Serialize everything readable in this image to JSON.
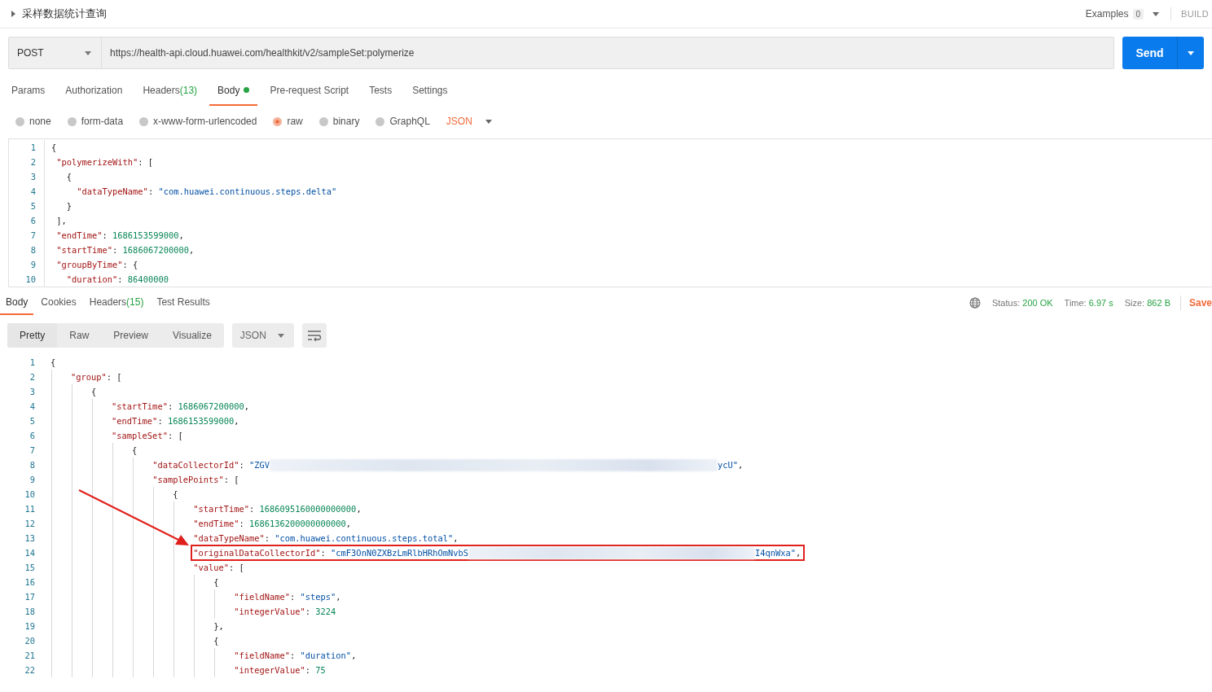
{
  "header": {
    "title": "采样数据统计查询",
    "examples_label": "Examples",
    "examples_count": "0",
    "build_label": "BUILD"
  },
  "request": {
    "method": "POST",
    "url": "https://health-api.cloud.huawei.com/healthkit/v2/sampleSet:polymerize",
    "send_label": "Send"
  },
  "request_tabs": [
    {
      "label": "Params",
      "selected": false
    },
    {
      "label": "Authorization",
      "selected": false
    },
    {
      "label": "Headers",
      "count": "(13)",
      "selected": false
    },
    {
      "label": "Body",
      "has_content": true,
      "selected": true
    },
    {
      "label": "Pre-request Script",
      "selected": false
    },
    {
      "label": "Tests",
      "selected": false
    },
    {
      "label": "Settings",
      "selected": false
    }
  ],
  "body_types": [
    {
      "label": "none",
      "selected": false
    },
    {
      "label": "form-data",
      "selected": false
    },
    {
      "label": "x-www-form-urlencoded",
      "selected": false
    },
    {
      "label": "raw",
      "selected": true
    },
    {
      "label": "binary",
      "selected": false
    },
    {
      "label": "GraphQL",
      "selected": false
    }
  ],
  "body_format": "JSON",
  "request_editor": {
    "lines": [
      {
        "number": "1",
        "highlighted": false,
        "tokens": [
          {
            "kind": "punct",
            "text": "{"
          }
        ]
      },
      {
        "number": "2",
        "highlighted": false,
        "tokens": [
          {
            "kind": "key",
            "text": " \"polymerizeWith\""
          },
          {
            "kind": "punct",
            "text": ": ["
          }
        ]
      },
      {
        "number": "3",
        "highlighted": false,
        "tokens": [
          {
            "kind": "punct",
            "text": "   {"
          }
        ]
      },
      {
        "number": "4",
        "highlighted": false,
        "tokens": [
          {
            "kind": "key",
            "text": "     \"dataTypeName\""
          },
          {
            "kind": "punct",
            "text": ": "
          },
          {
            "kind": "string",
            "text": "\"com.huawei.continuous.steps.delta\""
          }
        ]
      },
      {
        "number": "5",
        "highlighted": false,
        "tokens": [
          {
            "kind": "punct",
            "text": "   }"
          }
        ]
      },
      {
        "number": "6",
        "highlighted": false,
        "tokens": [
          {
            "kind": "punct",
            "text": " ],"
          }
        ]
      },
      {
        "number": "7",
        "highlighted": false,
        "tokens": [
          {
            "kind": "key",
            "text": " \"endTime\""
          },
          {
            "kind": "punct",
            "text": ": "
          },
          {
            "kind": "number",
            "text": "1686153599000"
          },
          {
            "kind": "punct",
            "text": ","
          }
        ]
      },
      {
        "number": "8",
        "highlighted": false,
        "tokens": [
          {
            "kind": "key",
            "text": " \"startTime\""
          },
          {
            "kind": "punct",
            "text": ": "
          },
          {
            "kind": "number",
            "text": "1686067200000"
          },
          {
            "kind": "punct",
            "text": ","
          }
        ]
      },
      {
        "number": "9",
        "highlighted": false,
        "tokens": [
          {
            "kind": "key",
            "text": " \"groupByTime\""
          },
          {
            "kind": "punct",
            "text": ": {"
          }
        ]
      },
      {
        "number": "10",
        "highlighted": false,
        "tokens": [
          {
            "kind": "key",
            "text": "   \"duration\""
          },
          {
            "kind": "punct",
            "text": ": "
          },
          {
            "kind": "number",
            "text": "86400000"
          }
        ]
      }
    ]
  },
  "response_tabs": [
    {
      "label": "Body",
      "selected": true
    },
    {
      "label": "Cookies",
      "selected": false
    },
    {
      "label": "Headers",
      "count": "(15)",
      "selected": false
    },
    {
      "label": "Test Results",
      "selected": false
    }
  ],
  "response_stats": [
    {
      "label": "Status:",
      "value": "200 OK"
    },
    {
      "label": "Time:",
      "value": "6.97 s"
    },
    {
      "label": "Size:",
      "value": "862 B"
    }
  ],
  "save_label": "Save",
  "view_modes": [
    {
      "label": "Pretty",
      "selected": true
    },
    {
      "label": "Raw",
      "selected": false
    },
    {
      "label": "Preview",
      "selected": false
    },
    {
      "label": "Visualize",
      "selected": false
    }
  ],
  "response_format": "JSON",
  "response_editor": {
    "lines": [
      {
        "number": "1",
        "highlighted": false,
        "tokens": [
          {
            "kind": "punct",
            "text": "{"
          }
        ]
      },
      {
        "number": "2",
        "highlighted": false,
        "tokens": [
          {
            "kind": "key",
            "text": "    \"group\""
          },
          {
            "kind": "punct",
            "text": ": ["
          }
        ]
      },
      {
        "number": "3",
        "highlighted": false,
        "tokens": [
          {
            "kind": "punct",
            "text": "        {"
          }
        ]
      },
      {
        "number": "4",
        "highlighted": false,
        "tokens": [
          {
            "kind": "key",
            "text": "            \"startTime\""
          },
          {
            "kind": "punct",
            "text": ": "
          },
          {
            "kind": "number",
            "text": "1686067200000"
          },
          {
            "kind": "punct",
            "text": ","
          }
        ]
      },
      {
        "number": "5",
        "highlighted": false,
        "tokens": [
          {
            "kind": "key",
            "text": "            \"endTime\""
          },
          {
            "kind": "punct",
            "text": ": "
          },
          {
            "kind": "number",
            "text": "1686153599000"
          },
          {
            "kind": "punct",
            "text": ","
          }
        ]
      },
      {
        "number": "6",
        "highlighted": false,
        "tokens": [
          {
            "kind": "key",
            "text": "            \"sampleSet\""
          },
          {
            "kind": "punct",
            "text": ": ["
          }
        ]
      },
      {
        "number": "7",
        "highlighted": false,
        "tokens": [
          {
            "kind": "punct",
            "text": "                {"
          }
        ]
      },
      {
        "number": "8",
        "highlighted": false,
        "tokens": [
          {
            "kind": "key",
            "text": "                    \"dataCollectorId\""
          },
          {
            "kind": "punct",
            "text": ": "
          },
          {
            "kind": "string",
            "text": "\"ZGV"
          },
          {
            "kind": "redacted"
          },
          {
            "kind": "string",
            "text": "ycU\""
          },
          {
            "kind": "punct",
            "text": ","
          }
        ]
      },
      {
        "number": "9",
        "highlighted": false,
        "tokens": [
          {
            "kind": "key",
            "text": "                    \"samplePoints\""
          },
          {
            "kind": "punct",
            "text": ": ["
          }
        ]
      },
      {
        "number": "10",
        "highlighted": false,
        "tokens": [
          {
            "kind": "punct",
            "text": "                        {"
          }
        ]
      },
      {
        "number": "11",
        "highlighted": false,
        "tokens": [
          {
            "kind": "key",
            "text": "                            \"startTime\""
          },
          {
            "kind": "punct",
            "text": ": "
          },
          {
            "kind": "number",
            "text": "1686095160000000000"
          },
          {
            "kind": "punct",
            "text": ","
          }
        ]
      },
      {
        "number": "12",
        "highlighted": false,
        "tokens": [
          {
            "kind": "key",
            "text": "                            \"endTime\""
          },
          {
            "kind": "punct",
            "text": ": "
          },
          {
            "kind": "number",
            "text": "1686136200000000000"
          },
          {
            "kind": "punct",
            "text": ","
          }
        ]
      },
      {
        "number": "13",
        "highlighted": false,
        "tokens": [
          {
            "kind": "key",
            "text": "                            \"dataTypeName\""
          },
          {
            "kind": "punct",
            "text": ": "
          },
          {
            "kind": "string",
            "text": "\"com.huawei.continuous.steps.total\""
          },
          {
            "kind": "punct",
            "text": ","
          }
        ]
      },
      {
        "number": "14",
        "highlighted": true,
        "tokens": [
          {
            "kind": "key",
            "text": "                            \"originalDataCollectorId\""
          },
          {
            "kind": "punct",
            "text": ": "
          },
          {
            "kind": "string",
            "text": "\"cmF3OnN0ZXBzLmRlbHRhOmNvbS"
          },
          {
            "kind": "redacted"
          },
          {
            "kind": "string",
            "text": "I4qnWxa\""
          },
          {
            "kind": "punct",
            "text": ","
          }
        ]
      },
      {
        "number": "15",
        "highlighted": false,
        "tokens": [
          {
            "kind": "key",
            "text": "                            \"value\""
          },
          {
            "kind": "punct",
            "text": ": ["
          }
        ]
      },
      {
        "number": "16",
        "highlighted": false,
        "tokens": [
          {
            "kind": "punct",
            "text": "                                {"
          }
        ]
      },
      {
        "number": "17",
        "highlighted": false,
        "tokens": [
          {
            "kind": "key",
            "text": "                                    \"fieldName\""
          },
          {
            "kind": "punct",
            "text": ": "
          },
          {
            "kind": "string",
            "text": "\"steps\""
          },
          {
            "kind": "punct",
            "text": ","
          }
        ]
      },
      {
        "number": "18",
        "highlighted": false,
        "tokens": [
          {
            "kind": "key",
            "text": "                                    \"integerValue\""
          },
          {
            "kind": "punct",
            "text": ": "
          },
          {
            "kind": "number",
            "text": "3224"
          }
        ]
      },
      {
        "number": "19",
        "highlighted": false,
        "tokens": [
          {
            "kind": "punct",
            "text": "                                },"
          }
        ]
      },
      {
        "number": "20",
        "highlighted": false,
        "tokens": [
          {
            "kind": "punct",
            "text": "                                {"
          }
        ]
      },
      {
        "number": "21",
        "highlighted": false,
        "tokens": [
          {
            "kind": "key",
            "text": "                                    \"fieldName\""
          },
          {
            "kind": "punct",
            "text": ": "
          },
          {
            "kind": "string",
            "text": "\"duration\""
          },
          {
            "kind": "punct",
            "text": ","
          }
        ]
      },
      {
        "number": "22",
        "highlighted": false,
        "tokens": [
          {
            "kind": "key",
            "text": "                                    \"integerValue\""
          },
          {
            "kind": "punct",
            "text": ": "
          },
          {
            "kind": "number",
            "text": "75"
          }
        ]
      }
    ]
  }
}
